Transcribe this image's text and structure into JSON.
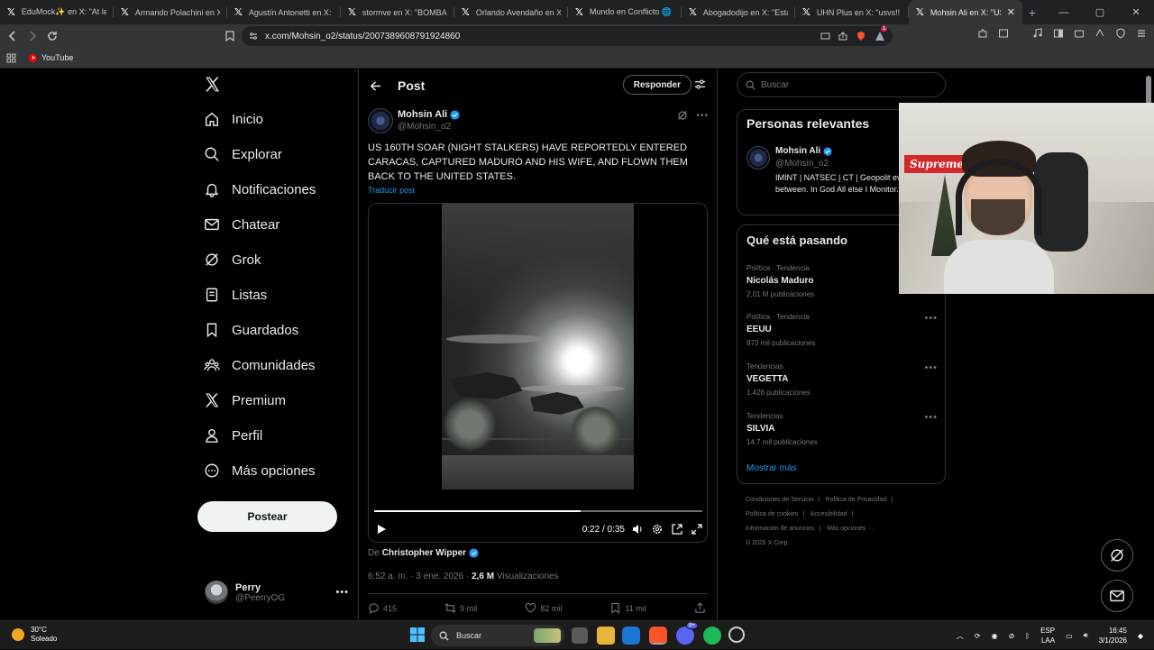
{
  "browser": {
    "tabs": [
      {
        "title": "EduMock✨ en X: \"At least",
        "active": false
      },
      {
        "title": "Armando Polachini en X: \"S",
        "active": false
      },
      {
        "title": "Agustín Antonetti en X: \"H",
        "active": false
      },
      {
        "title": "stormve en X: \"BOMBARDEO",
        "active": false
      },
      {
        "title": "Orlando Avendaño en X: \"A",
        "active": false
      },
      {
        "title": "Mundo en Conflicto 🌐 en",
        "active": false
      },
      {
        "title": "Abogadodijo en X: \"Está p",
        "active": false
      },
      {
        "title": "UHN Plus en X: \"usvs!! | Últ",
        "active": false
      },
      {
        "title": "Mohsin Ali en X: \"US",
        "active": true
      }
    ],
    "url": "x.com/Mohsin_o2/status/2007389608791924860",
    "bookmarks": [
      "YouTube"
    ],
    "brave_badge": "1"
  },
  "nav": {
    "items": [
      "Inicio",
      "Explorar",
      "Notificaciones",
      "Chatear",
      "Grok",
      "Listas",
      "Guardados",
      "Comunidades",
      "Premium",
      "Perfil",
      "Más opciones"
    ],
    "post_button": "Postear",
    "account": {
      "name": "Perry",
      "handle": "@PeerryOG"
    }
  },
  "post": {
    "header_title": "Post",
    "reply_button": "Responder",
    "author_name": "Mohsin Ali",
    "author_handle": "@Mohsin_o2",
    "text": "US 160TH SOAR (NIGHT STALKERS) HAVE REPORTEDLY ENTERED CARACAS, CAPTURED MADURO AND HIS WIFE, AND FLOWN THEM BACK TO THE UNITED STATES.",
    "translate": "Traducir post",
    "video_time": "0:22 / 0:35",
    "video_progress": 0.63,
    "from_label": "De",
    "from_name": "Christopher Wipper",
    "timestamp": "6:52 a. m. · 3 ene. 2026 ·",
    "views": "2,6 M",
    "views_label": "Visualizaciones",
    "replies": "415",
    "reposts": "9 mil",
    "likes": "82 mil",
    "bookmarks": "11 mil"
  },
  "sidebar": {
    "search_placeholder": "Buscar",
    "relevant_title": "Personas relevantes",
    "relevant": {
      "name": "Mohsin Ali",
      "handle": "@Mohsin_o2",
      "bio": "IMINT | NATSEC | CT | Geopolit everything in between. In God All else I Monitor..."
    },
    "trending_title": "Qué está pasando",
    "trends": [
      {
        "category": "Política · Tendencia",
        "name": "Nicolás Maduro",
        "count": "2,01 M publicaciones"
      },
      {
        "category": "Política · Tendencia",
        "name": "EEUU",
        "count": "873 mil publicaciones"
      },
      {
        "category": "Tendencias",
        "name": "VEGETTA",
        "count": "1.426 publicaciones"
      },
      {
        "category": "Tendencias",
        "name": "SILVIA",
        "count": "14,7 mil publicaciones"
      }
    ],
    "show_more": "Mostrar más",
    "footer": [
      "Condiciones de Servicio",
      "|",
      "Política de Privacidad",
      "|",
      "Política de cookies",
      "|",
      "Accesibilidad",
      "|",
      "Información de anuncios",
      "|",
      "Más opciones ···",
      "© 2026 X Corp."
    ]
  },
  "overlay": {
    "cam_logo": "Supreme"
  },
  "taskbar": {
    "temp": "30°C",
    "weather": "Soleado",
    "search": "Buscar",
    "lang1": "ESP",
    "lang2": "LAA",
    "time": "16:45",
    "date": "3/1/2026",
    "discord_badge": "9+"
  },
  "colors": {
    "accent": "#1d9bf0",
    "bg": "#000000",
    "border": "#2f3336",
    "muted": "#71767b"
  }
}
